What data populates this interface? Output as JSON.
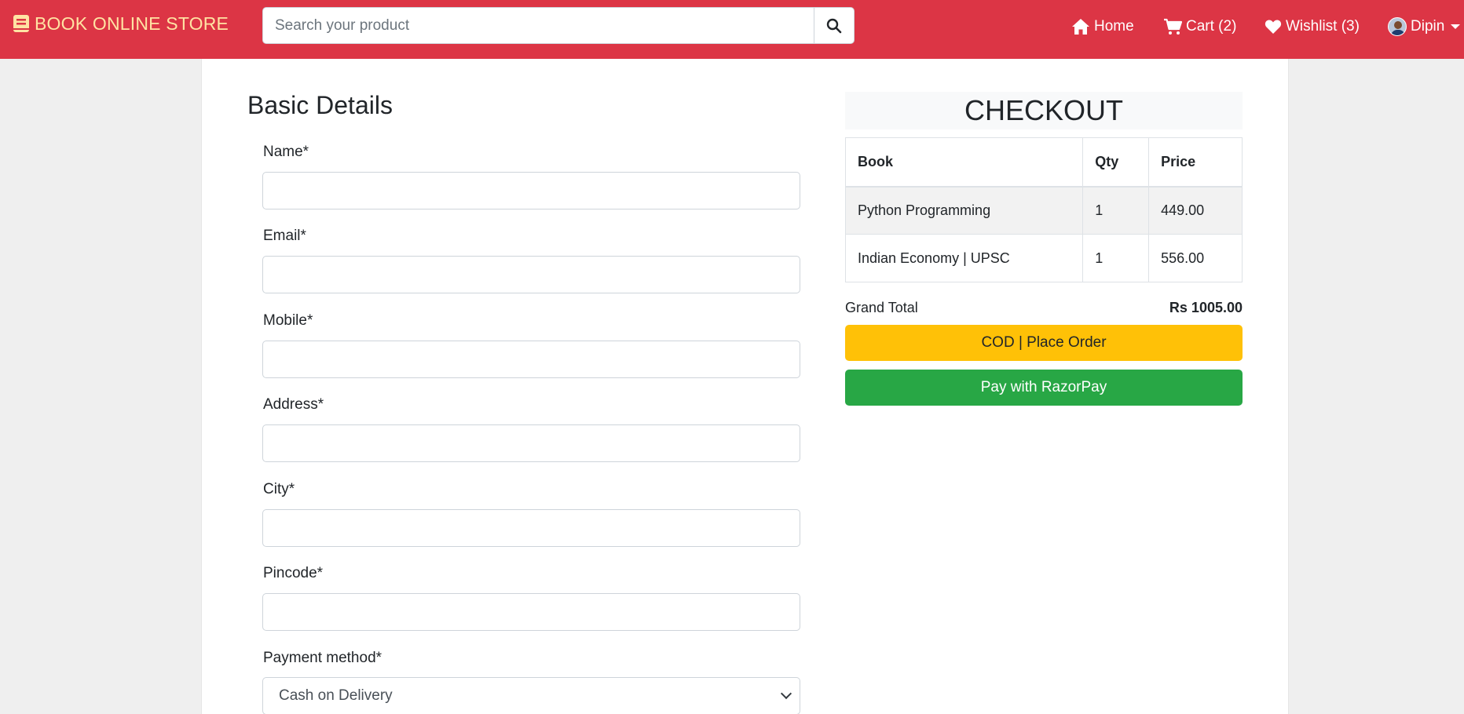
{
  "navbar": {
    "brand": "BOOK ONLINE STORE",
    "search_placeholder": "Search your product",
    "home_label": "Home",
    "cart_label": "Cart (2)",
    "wishlist_label": "Wishlist (3)",
    "user_label": "Dipin"
  },
  "form": {
    "title": "Basic Details",
    "name_label": "Name*",
    "email_label": "Email*",
    "mobile_label": "Mobile*",
    "address_label": "Address*",
    "city_label": "City*",
    "pincode_label": "Pincode*",
    "payment_label": "Payment method*",
    "payment_selected": "Cash on Delivery"
  },
  "checkout": {
    "title": "CHECKOUT",
    "columns": [
      "Book",
      "Qty",
      "Price"
    ],
    "items": [
      {
        "book": "Python Programming",
        "qty": "1",
        "price": "449.00"
      },
      {
        "book": "Indian Economy | UPSC",
        "qty": "1",
        "price": "556.00"
      }
    ],
    "grand_total_label": "Grand Total",
    "grand_total_value": "Rs 1005.00",
    "cod_button": "COD | Place Order",
    "razorpay_button": "Pay with RazorPay"
  },
  "colors": {
    "navbar": "#dc3545",
    "brand": "#ffe3a3",
    "cod": "#ffc107",
    "razorpay": "#28a745"
  }
}
